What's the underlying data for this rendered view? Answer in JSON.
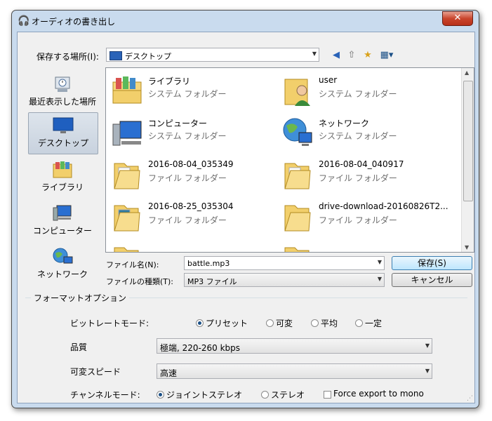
{
  "window": {
    "title": "オーディオの書き出し",
    "close_glyph": "✕",
    "icon": "headphones-icon"
  },
  "location": {
    "label": "保存する場所(I):",
    "value": "デスクトップ"
  },
  "places": [
    {
      "label": "最近表示した場所",
      "icon": "recent-places-icon"
    },
    {
      "label": "デスクトップ",
      "icon": "desktop-icon",
      "selected": true
    },
    {
      "label": "ライブラリ",
      "icon": "libraries-icon"
    },
    {
      "label": "コンピューター",
      "icon": "computer-icon"
    },
    {
      "label": "ネットワーク",
      "icon": "network-icon"
    }
  ],
  "files": [
    {
      "name": "ライブラリ",
      "type": "システム フォルダー",
      "icon": "libraries-icon"
    },
    {
      "name": "user",
      "type": "システム フォルダー",
      "icon": "user-icon"
    },
    {
      "name": "コンピューター",
      "type": "システム フォルダー",
      "icon": "computer-icon"
    },
    {
      "name": "ネットワーク",
      "type": "システム フォルダー",
      "icon": "network-icon"
    },
    {
      "name": "2016-08-04_035349",
      "type": "ファイル フォルダー",
      "icon": "folder-icon"
    },
    {
      "name": "2016-08-04_040917",
      "type": "ファイル フォルダー",
      "icon": "folder-icon"
    },
    {
      "name": "2016-08-25_035304",
      "type": "ファイル フォルダー",
      "icon": "folder-icon"
    },
    {
      "name": "drive-download-20160826T2...",
      "type": "ファイル フォルダー",
      "icon": "folder-icon"
    }
  ],
  "filename": {
    "label": "ファイル名(N):",
    "value": "battle.mp3"
  },
  "filetype": {
    "label": "ファイルの種類(T):",
    "value": "MP3 ファイル"
  },
  "buttons": {
    "save": "保存(S)",
    "cancel": "キャンセル"
  },
  "format": {
    "title": "フォーマットオプション",
    "bitrate_label": "ビットレートモード:",
    "bitrate_options": [
      "プリセット",
      "可変",
      "平均",
      "一定"
    ],
    "quality_label": "品質",
    "quality_value": "極端, 220-260 kbps",
    "speed_label": "可変スピード",
    "speed_value": "高速",
    "channel_label": "チャンネルモード:",
    "channel_options": [
      "ジョイントステレオ",
      "ステレオ"
    ],
    "force_mono": "Force export to mono"
  }
}
